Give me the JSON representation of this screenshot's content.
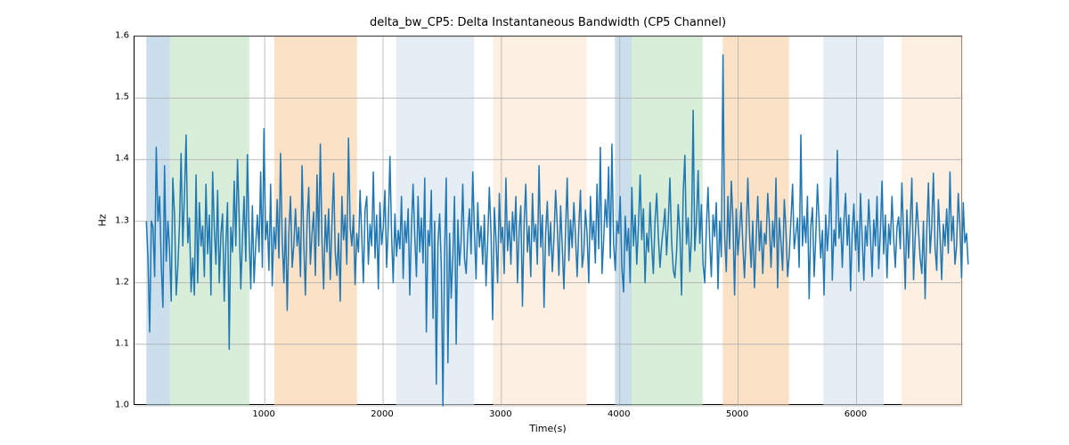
{
  "chart_data": {
    "type": "line",
    "title": "delta_bw_CP5: Delta Instantaneous Bandwidth (CP5 Channel)",
    "xlabel": "Time(s)",
    "ylabel": "Hz",
    "xlim": [
      -100,
      6900
    ],
    "ylim": [
      1.0,
      1.6
    ],
    "xticks": [
      1000,
      2000,
      3000,
      4000,
      5000,
      6000
    ],
    "yticks": [
      1.0,
      1.1,
      1.2,
      1.3,
      1.4,
      1.5,
      1.6
    ],
    "bands": [
      {
        "x0": 0,
        "x1": 200,
        "color": "#a8c8e0",
        "alpha": 0.6
      },
      {
        "x0": 200,
        "x1": 870,
        "color": "#c0e2c0",
        "alpha": 0.6
      },
      {
        "x0": 1080,
        "x1": 1780,
        "color": "#f8cfa2",
        "alpha": 0.6
      },
      {
        "x0": 2110,
        "x1": 2770,
        "color": "#d5e3ef",
        "alpha": 0.6
      },
      {
        "x0": 2930,
        "x1": 3720,
        "color": "#fce6cf",
        "alpha": 0.6
      },
      {
        "x0": 3960,
        "x1": 4100,
        "color": "#a8c8e0",
        "alpha": 0.6
      },
      {
        "x0": 4100,
        "x1": 4700,
        "color": "#c0e2c0",
        "alpha": 0.6
      },
      {
        "x0": 4870,
        "x1": 5430,
        "color": "#f8cfa2",
        "alpha": 0.6
      },
      {
        "x0": 5720,
        "x1": 6230,
        "color": "#d5e3ef",
        "alpha": 0.6
      },
      {
        "x0": 6380,
        "x1": 6900,
        "color": "#fce6cf",
        "alpha": 0.6
      }
    ],
    "series": [
      {
        "name": "delta_bw_CP5",
        "color": "#1f77b4",
        "x_step": 14,
        "y": [
          1.3,
          1.24,
          1.12,
          1.3,
          1.29,
          1.21,
          1.42,
          1.3,
          1.34,
          1.23,
          1.16,
          1.39,
          1.235,
          1.3,
          1.255,
          1.17,
          1.37,
          1.31,
          1.18,
          1.225,
          1.295,
          1.41,
          1.26,
          1.345,
          1.44,
          1.265,
          1.305,
          1.185,
          1.24,
          1.18,
          1.375,
          1.2,
          1.33,
          1.26,
          1.292,
          1.21,
          1.36,
          1.247,
          1.31,
          1.18,
          1.38,
          1.29,
          1.23,
          1.35,
          1.2,
          1.28,
          1.312,
          1.17,
          1.265,
          1.33,
          1.092,
          1.29,
          1.25,
          1.365,
          1.26,
          1.4,
          1.31,
          1.19,
          1.275,
          1.34,
          1.235,
          1.408,
          1.28,
          1.19,
          1.325,
          1.2,
          1.26,
          1.31,
          1.25,
          1.38,
          1.225,
          1.45,
          1.27,
          1.3,
          1.22,
          1.36,
          1.195,
          1.29,
          1.255,
          1.335,
          1.24,
          1.41,
          1.27,
          1.2,
          1.305,
          1.155,
          1.28,
          1.34,
          1.225,
          1.26,
          1.32,
          1.26,
          1.29,
          1.21,
          1.39,
          1.265,
          1.18,
          1.3,
          1.355,
          1.23,
          1.28,
          1.315,
          1.212,
          1.375,
          1.26,
          1.425,
          1.27,
          1.19,
          1.31,
          1.25,
          1.32,
          1.205,
          1.295,
          1.378,
          1.25,
          1.212,
          1.28,
          1.17,
          1.34,
          1.27,
          1.31,
          1.23,
          1.435,
          1.29,
          1.26,
          1.31,
          1.197,
          1.28,
          1.25,
          1.35,
          1.275,
          1.2,
          1.318,
          1.34,
          1.23,
          1.295,
          1.26,
          1.38,
          1.24,
          1.31,
          1.19,
          1.33,
          1.262,
          1.29,
          1.35,
          1.225,
          1.29,
          1.405,
          1.275,
          1.2,
          1.312,
          1.243,
          1.285,
          1.255,
          1.34,
          1.207,
          1.3,
          1.265,
          1.32,
          1.18,
          1.29,
          1.36,
          1.275,
          1.21,
          1.34,
          1.25,
          1.305,
          1.232,
          1.37,
          1.12,
          1.285,
          1.26,
          1.35,
          1.142,
          1.3,
          1.035,
          1.262,
          1.312,
          1.225,
          1.0,
          1.25,
          1.37,
          1.07,
          1.28,
          1.175,
          1.245,
          1.34,
          1.1,
          1.302,
          1.228,
          1.27,
          1.36,
          1.24,
          1.215,
          1.28,
          1.32,
          1.247,
          1.38,
          1.282,
          1.206,
          1.33,
          1.258,
          1.292,
          1.23,
          1.31,
          1.195,
          1.265,
          1.355,
          1.28,
          1.14,
          1.322,
          1.272,
          1.2,
          1.345,
          1.265,
          1.29,
          1.215,
          1.37,
          1.252,
          1.3,
          1.23,
          1.315,
          1.268,
          1.34,
          1.2,
          1.285,
          1.325,
          1.162,
          1.3,
          1.36,
          1.25,
          1.292,
          1.21,
          1.345,
          1.267,
          1.295,
          1.23,
          1.39,
          1.258,
          1.31,
          1.16,
          1.28,
          1.332,
          1.244,
          1.298,
          1.218,
          1.27,
          1.35,
          1.292,
          1.212,
          1.325,
          1.26,
          1.19,
          1.285,
          1.37,
          1.236,
          1.302,
          1.257,
          1.33,
          1.275,
          1.21,
          1.29,
          1.35,
          1.225,
          1.248,
          1.318,
          1.28,
          1.2,
          1.34,
          1.27,
          1.3,
          1.232,
          1.36,
          1.255,
          1.42,
          1.215,
          1.268,
          1.335,
          1.29,
          1.388,
          1.24,
          1.425,
          1.263,
          1.22,
          1.3,
          1.28,
          1.34,
          1.224,
          1.185,
          1.308,
          1.252,
          1.288,
          1.2,
          1.355,
          1.26,
          1.31,
          1.23,
          1.292,
          1.375,
          1.27,
          1.32,
          1.2,
          1.28,
          1.25,
          1.33,
          1.262,
          1.215,
          1.3,
          1.345,
          1.275,
          1.225,
          1.262,
          1.29,
          1.32,
          1.245,
          1.3,
          1.37,
          1.268,
          1.22,
          1.208,
          1.25,
          1.327,
          1.28,
          1.18,
          1.345,
          1.407,
          1.263,
          1.305,
          1.218,
          1.275,
          1.48,
          1.252,
          1.3,
          1.382,
          1.264,
          1.327,
          1.231,
          1.2,
          1.292,
          1.355,
          1.268,
          1.21,
          1.31,
          1.275,
          1.33,
          1.19,
          1.3,
          1.242,
          1.57,
          1.278,
          1.218,
          1.34,
          1.255,
          1.365,
          1.304,
          1.18,
          1.32,
          1.245,
          1.283,
          1.33,
          1.26,
          1.208,
          1.28,
          1.37,
          1.282,
          1.225,
          1.3,
          1.192,
          1.27,
          1.34,
          1.252,
          1.3,
          1.215,
          1.28,
          1.263,
          1.345,
          1.296,
          1.225,
          1.3,
          1.258,
          1.37,
          1.192,
          1.305,
          1.265,
          1.22,
          1.335,
          1.288,
          1.21,
          1.245,
          1.3,
          1.36,
          1.255,
          1.28,
          1.305,
          1.225,
          1.44,
          1.26,
          1.308,
          1.265,
          1.34,
          1.174,
          1.29,
          1.322,
          1.21,
          1.272,
          1.36,
          1.302,
          1.24,
          1.285,
          1.18,
          1.31,
          1.252,
          1.295,
          1.37,
          1.204,
          1.286,
          1.26,
          1.415,
          1.272,
          1.305,
          1.225,
          1.298,
          1.345,
          1.261,
          1.31,
          1.187,
          1.28,
          1.328,
          1.253,
          1.3,
          1.218,
          1.345,
          1.275,
          1.204,
          1.292,
          1.26,
          1.335,
          1.275,
          1.21,
          1.302,
          1.26,
          1.34,
          1.223,
          1.285,
          1.365,
          1.247,
          1.31,
          1.208,
          1.295,
          1.262,
          1.34,
          1.274,
          1.225,
          1.29,
          1.307,
          1.255,
          1.362,
          1.28,
          1.19,
          1.318,
          1.24,
          1.295,
          1.37,
          1.205,
          1.272,
          1.33,
          1.287,
          1.24,
          1.215,
          1.3,
          1.174,
          1.284,
          1.362,
          1.248,
          1.29,
          1.378,
          1.258,
          1.22,
          1.335,
          1.276,
          1.205,
          1.295,
          1.26,
          1.32,
          1.248,
          1.38,
          1.268,
          1.308,
          1.23,
          1.26,
          1.345,
          1.294,
          1.208,
          1.33,
          1.265,
          1.28,
          1.23
        ]
      }
    ]
  }
}
